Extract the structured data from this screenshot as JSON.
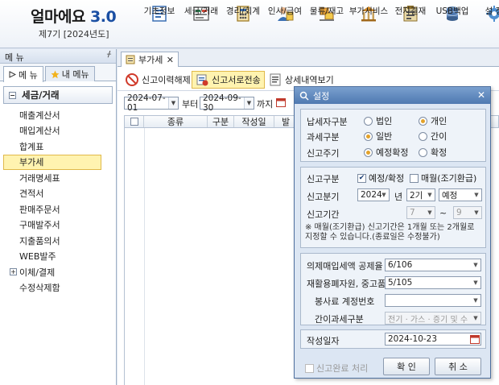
{
  "app": {
    "logo": "얼마에요",
    "version": "3.0",
    "period": "제7기 [2024년도]"
  },
  "toolbar": [
    {
      "label": "기초정보",
      "icon": "base-info-icon"
    },
    {
      "label": "세금/거래",
      "icon": "tax-trade-icon"
    },
    {
      "label": "경리/회계",
      "icon": "accounting-icon"
    },
    {
      "label": "인사/급여",
      "icon": "hr-payroll-icon"
    },
    {
      "label": "물류/재고",
      "icon": "logistics-icon"
    },
    {
      "label": "부가서비스",
      "icon": "addon-service-icon"
    },
    {
      "label": "전자결재",
      "icon": "e-approval-icon"
    },
    {
      "label": "USB백업",
      "icon": "usb-backup-icon"
    },
    {
      "label": "설 정",
      "icon": "settings-icon"
    }
  ],
  "sidebar": {
    "header": "메 뉴",
    "pin": "ᚋ",
    "tabs": [
      "메 뉴",
      "내 메뉴"
    ],
    "section": "세금/거래",
    "items": [
      "매출계산서",
      "매입계산서",
      "합계표",
      "부가세",
      "거래명세표",
      "견적서",
      "판매주문서",
      "구매발주서",
      "지출품의서",
      "WEB발주",
      "이체/결제",
      "수정삭제함"
    ],
    "selected_index": 3
  },
  "main": {
    "tab": "부가세",
    "actions": [
      "신고이력해제",
      "신고서로전송",
      "상세내역보기"
    ],
    "date_from": "2024-07-01",
    "from_suffix": "부터",
    "date_to": "2024-09-30",
    "to_suffix": "까지",
    "columns": [
      "",
      "종류",
      "구분",
      "작성일",
      "발"
    ]
  },
  "dialog": {
    "title": "설정",
    "taxpayer_label": "납세자구분",
    "taxpayer_options": [
      "법인",
      "개인"
    ],
    "taxpayer_selected": "개인",
    "taxtype_label": "과세구분",
    "taxtype_options": [
      "일반",
      "간이"
    ],
    "taxtype_selected": "일반",
    "cycle_label": "신고주기",
    "cycle_options": [
      "예정확정",
      "확정"
    ],
    "cycle_selected": "예정확정",
    "report_type_label": "신고구분",
    "report_type_options": [
      "예정/확정",
      "매월(조기환급)"
    ],
    "report_type_checked": "예정/확정",
    "quarter_label": "신고분기",
    "quarter_year": "2024",
    "quarter_year_suffix": "년",
    "quarter_period": "2기",
    "quarter_kind": "예정",
    "range_label": "신고기간",
    "range_from": "7",
    "range_sep": "~",
    "range_to": "9",
    "note": "※ 매월(조기환급) 신고기간은 1개월 또는 2개월로 지정할 수 있습니다.(종료일은 수정불가)",
    "deemed_label": "의제매입세액 공제율",
    "deemed_value": "6/106",
    "recycle_label": "재활용폐자원, 중고품",
    "recycle_value": "5/105",
    "service_label": "봉사료 계정번호",
    "service_value": "",
    "simple_label": "간이과세구분",
    "simple_value": "전기 · 가스 · 증기 및 수",
    "date_label": "작성일자",
    "date_value": "2024-10-23",
    "complete_label": "신고완료 처리",
    "ok": "확 인",
    "cancel": "취 소"
  },
  "colors": {
    "accent": "#4f79b1",
    "highlight": "#fff3b0",
    "radio_on": "#e3a22a"
  }
}
